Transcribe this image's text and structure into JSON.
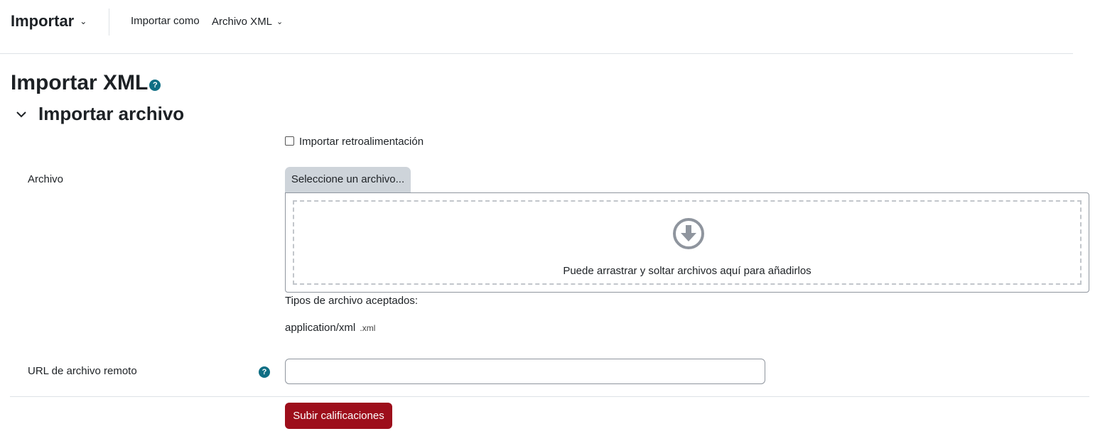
{
  "topbar": {
    "title": "Importar",
    "import_as_label": "Importar como",
    "import_as_value": "Archivo XML"
  },
  "page": {
    "title": "Importar XML",
    "help_glyph": "?"
  },
  "section": {
    "title": "Importar archivo"
  },
  "form": {
    "feedback_checkbox_label": "Importar retroalimentación",
    "feedback_checked": false,
    "file_label": "Archivo",
    "file_button": "Seleccione un archivo...",
    "dropzone_text": "Puede arrastrar y soltar archivos aquí para añadirlos",
    "accepted_label": "Tipos de archivo aceptados:",
    "accepted_type": "application/xml",
    "accepted_ext": ".xml",
    "url_label": "URL de archivo remoto",
    "url_value": "",
    "submit_label": "Subir calificaciones"
  },
  "colors": {
    "help_icon": "#0f6e84",
    "submit_bg": "#9d0e1b",
    "file_button_bg": "#ced4da"
  },
  "icons": {
    "title_chevron": "chevron-down-icon",
    "section_chevron": "chevron-down-icon",
    "help": "question-circle-icon",
    "dropzone": "arrow-circle-down-icon"
  }
}
